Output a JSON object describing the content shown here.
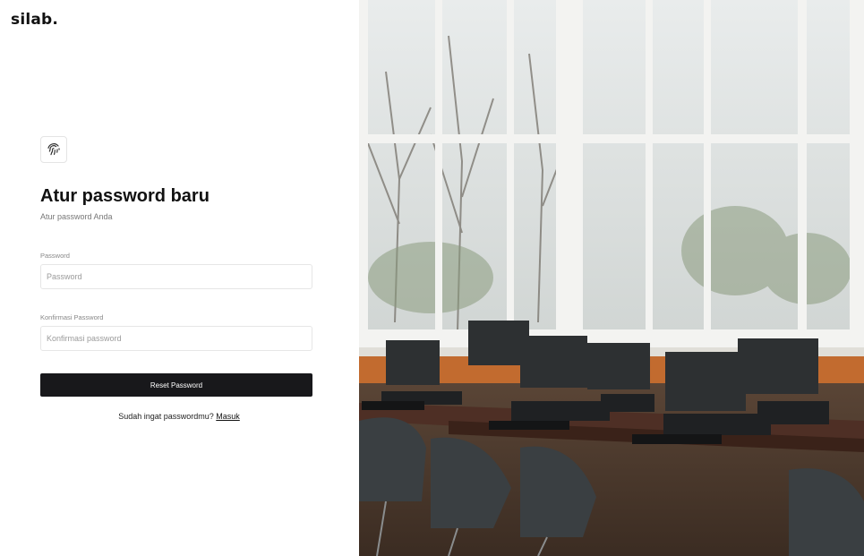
{
  "brand": {
    "logo_text": "silab."
  },
  "form": {
    "icon": "fingerprint-icon",
    "title": "Atur password baru",
    "subtitle": "Atur password Anda",
    "password_label": "Password",
    "password_placeholder": "Password",
    "confirm_label": "Konfirmasi Password",
    "confirm_placeholder": "Konfirmasi password",
    "submit_label": "Reset Password",
    "remember_text": "Sudah ingat passwordmu?",
    "login_link": "Masuk"
  },
  "colors": {
    "button_bg": "#18181b",
    "button_text": "#ffffff",
    "border": "#e6e6e6"
  }
}
